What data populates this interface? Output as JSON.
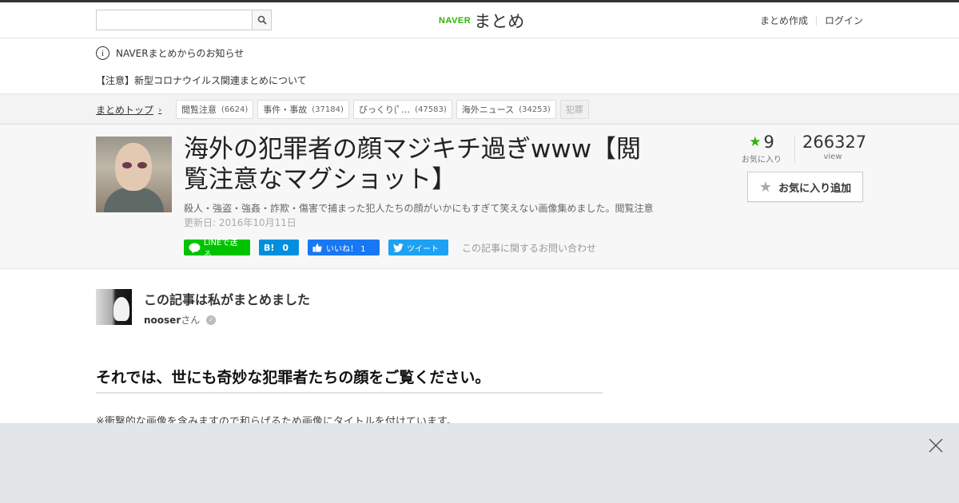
{
  "header": {
    "search_placeholder": "",
    "logo_brand": "NAVER",
    "logo_text": "まとめ",
    "nav": [
      "まとめ作成",
      "ログイン"
    ]
  },
  "notice": {
    "title": "NAVERまとめからのお知らせ",
    "item": "【注意】新型コロナウイルス関連まとめについて"
  },
  "breadcrumb": {
    "top": "まとめトップ",
    "tags": [
      {
        "label": "閲覧注意",
        "count": "(6624)"
      },
      {
        "label": "事件・事故",
        "count": "(37184)"
      },
      {
        "label": "びっくり(ﾟ…",
        "count": "(47583)"
      },
      {
        "label": "海外ニュース",
        "count": "(34253)"
      },
      {
        "label": "犯罪",
        "count": ""
      }
    ]
  },
  "article": {
    "title": "海外の犯罪者の顔マジキチ過ぎwww【閲覧注意なマグショット】",
    "description": "殺人・強盗・強姦・詐欺・傷害で捕まった犯人たちの顔がいかにもすぎて笑えない画像集めました。閲覧注意",
    "updated": "更新日: 2016年10月11日",
    "share": {
      "line": "LINEで送る",
      "hatena_count": "0",
      "hatena_label": "B!",
      "facebook": "いいね！ 1",
      "twitter": "ツイート",
      "contact": "この記事に関するお問い合わせ"
    },
    "favorites": "9",
    "favorites_label": "お気に入り",
    "views": "266327",
    "views_label": "view",
    "fav_button": "お気に入り追加"
  },
  "author": {
    "heading": "この記事は私がまとめました",
    "name": "nooser",
    "suffix": "さん"
  },
  "content": {
    "section_title": "それでは、世にも奇妙な犯罪者たちの顔をご覧ください。",
    "text": "※衝撃的な画像を含みますので和らげるため画像にタイトルを付けています。"
  },
  "colors": {
    "naver_green": "#2db400",
    "line_green": "#00c300",
    "hatena_blue": "#008fde",
    "facebook_blue": "#1877f2",
    "twitter_blue": "#1da1f2"
  }
}
